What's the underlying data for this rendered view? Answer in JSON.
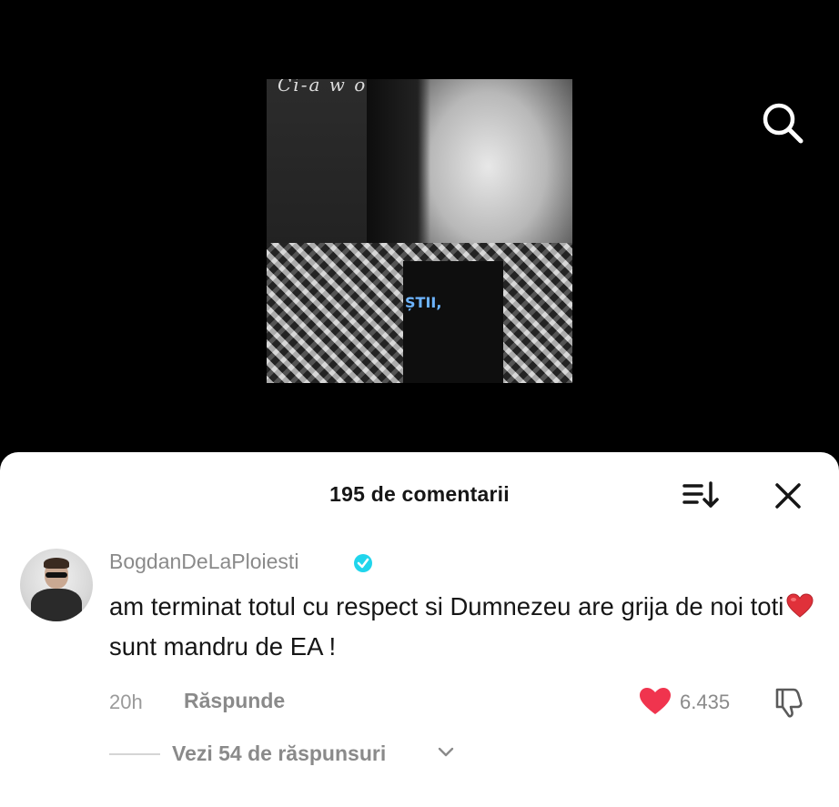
{
  "video": {
    "caption": "ȘTII,",
    "overlay_script": "Ci-a w o",
    "icons": {
      "search": "search-icon"
    }
  },
  "comments_sheet": {
    "title": "195 de comentarii",
    "icons": {
      "sort": "sort-icon",
      "close": "close-icon"
    },
    "comment": {
      "username": "BogdanDeLaPloiesti",
      "verified": true,
      "text_part1": "am terminat totul cu respect si Dumnezeu are grija de noi toti",
      "text_part2": "sunt mandru de EA !",
      "emoji": "heart-emoji",
      "timestamp": "20h",
      "reply_label": "Răspunde",
      "like_count": "6.435",
      "liked": true,
      "view_replies_label": "Vezi 54 de răspunsuri"
    }
  },
  "colors": {
    "background": "#000000",
    "sheet": "#ffffff",
    "like_red": "#f0344e",
    "verified_blue": "#20d5ec",
    "muted_text": "#8a8a8a"
  }
}
